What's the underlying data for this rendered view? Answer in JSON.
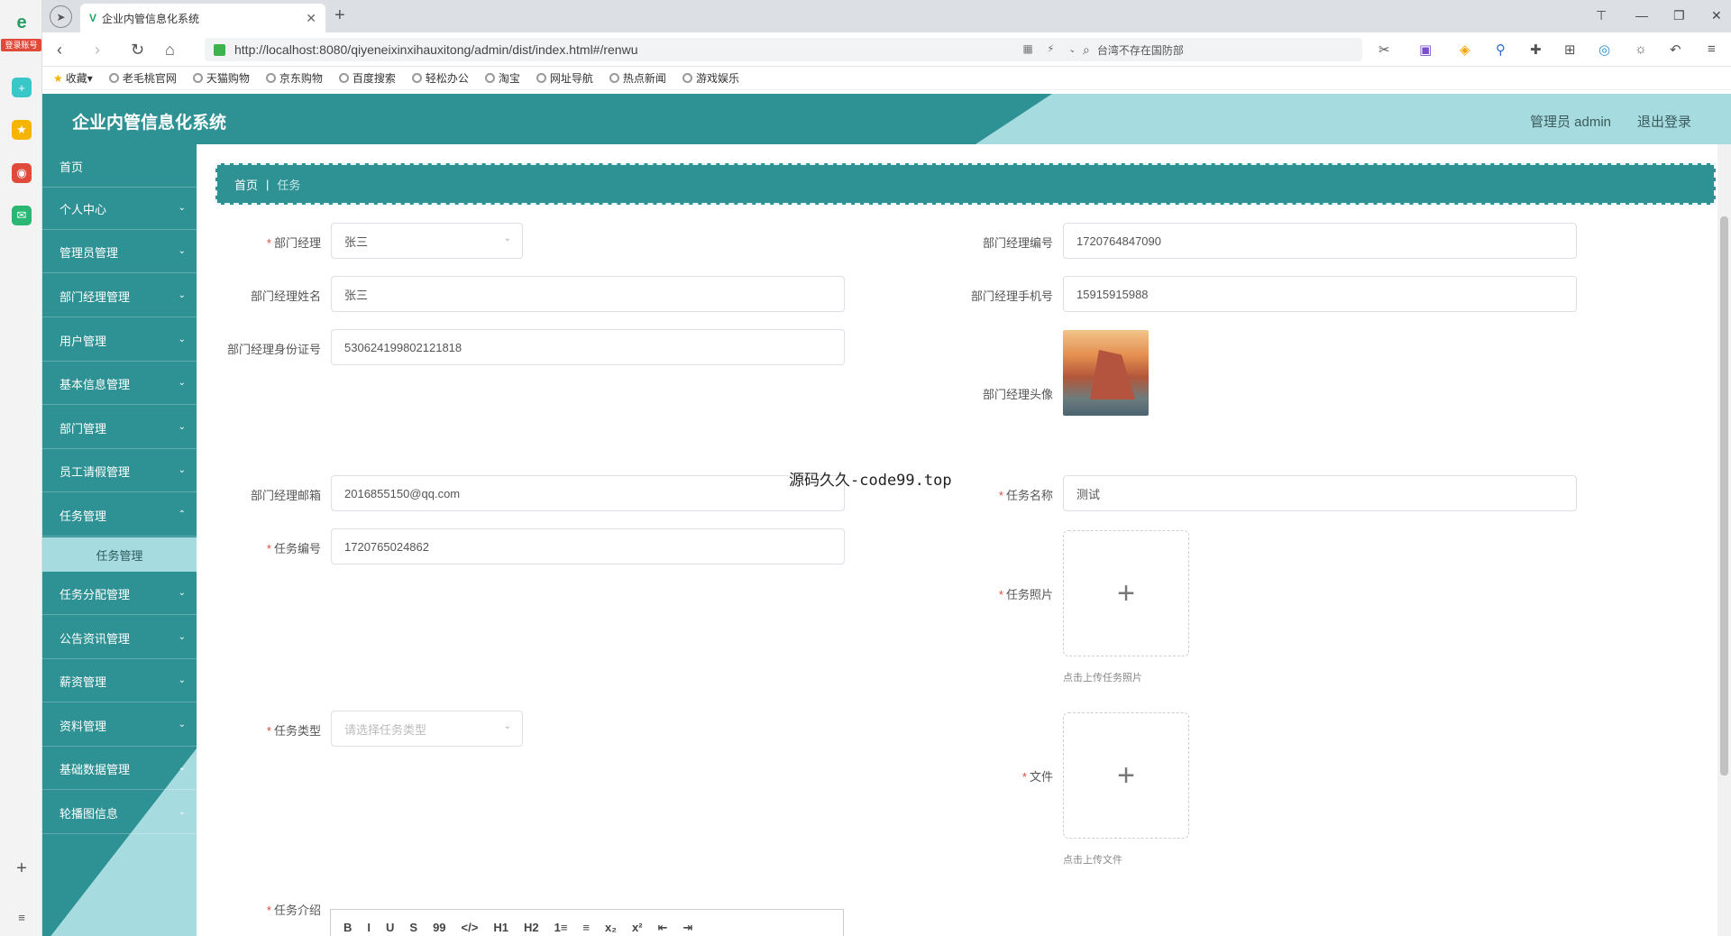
{
  "browser": {
    "rail_badge": "登录账号",
    "tab_title": "企业内管信息化系统",
    "url": "http://localhost:8080/qiyeneixinxihauxitong/admin/dist/index.html#/renwu",
    "search_text": "台湾不存在国防部",
    "bookmarks": [
      "收藏",
      "老毛桃官网",
      "天猫购物",
      "京东购物",
      "百度搜索",
      "轻松办公",
      "淘宝",
      "网址导航",
      "热点新闻",
      "游戏娱乐"
    ]
  },
  "header": {
    "title": "企业内管信息化系统",
    "user_label": "管理员 admin",
    "logout": "退出登录"
  },
  "sidebar": {
    "items": [
      {
        "label": "首页"
      },
      {
        "label": "个人中心"
      },
      {
        "label": "管理员管理"
      },
      {
        "label": "部门经理管理"
      },
      {
        "label": "用户管理"
      },
      {
        "label": "基本信息管理"
      },
      {
        "label": "部门管理"
      },
      {
        "label": "员工请假管理"
      },
      {
        "label": "任务管理"
      },
      {
        "label": "任务分配管理"
      },
      {
        "label": "公告资讯管理"
      },
      {
        "label": "薪资管理"
      },
      {
        "label": "资料管理"
      },
      {
        "label": "基础数据管理"
      },
      {
        "label": "轮播图信息"
      }
    ],
    "submenu_active": "任务管理"
  },
  "breadcrumb": {
    "home": "首页",
    "current": "任务"
  },
  "form": {
    "manager": {
      "label": "部门经理",
      "value": "张三"
    },
    "manager_no": {
      "label": "部门经理编号",
      "value": "1720764847090"
    },
    "manager_name": {
      "label": "部门经理姓名",
      "value": "张三"
    },
    "manager_phone": {
      "label": "部门经理手机号",
      "value": "15915915988"
    },
    "manager_id": {
      "label": "部门经理身份证号",
      "value": "530624199802121818"
    },
    "manager_avatar": {
      "label": "部门经理头像"
    },
    "manager_email": {
      "label": "部门经理邮箱",
      "value": "2016855150@qq.com"
    },
    "task_name": {
      "label": "任务名称",
      "value": "测试"
    },
    "task_no": {
      "label": "任务编号",
      "value": "1720765024862"
    },
    "task_photo": {
      "label": "任务照片",
      "hint": "点击上传任务照片"
    },
    "task_type": {
      "label": "任务类型",
      "placeholder": "请选择任务类型"
    },
    "file": {
      "label": "文件",
      "hint": "点击上传文件"
    },
    "task_intro": {
      "label": "任务介绍"
    }
  },
  "editor_tools": [
    "B",
    "I",
    "U",
    "S",
    "99",
    "</>",
    "H1",
    "H2",
    "1≡",
    "≡",
    "x₂",
    "x²",
    "⇤",
    "⇥"
  ],
  "overlay_text": "源码久久-code99.top",
  "colors": {
    "primary": "#2e9194",
    "light": "#a6dcdf",
    "required": "#e04a3a"
  }
}
